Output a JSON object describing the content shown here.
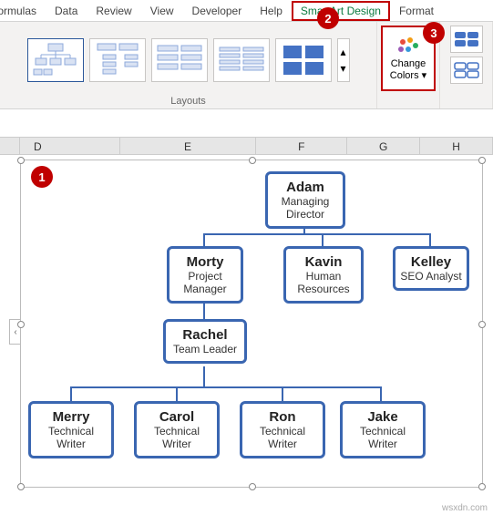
{
  "ribbon": {
    "tabs": [
      "Formulas",
      "Data",
      "Review",
      "View",
      "Developer",
      "Help",
      "SmartArt Design",
      "Format"
    ],
    "active_tab": "SmartArt Design",
    "groups": {
      "layouts": "Layouts"
    },
    "change_colors": {
      "label_line1": "Change",
      "label_line2": "Colors"
    }
  },
  "chart_data": {
    "type": "org-chart",
    "nodes": [
      {
        "id": "adam",
        "name": "Adam",
        "title": "Managing Director",
        "parent": null
      },
      {
        "id": "morty",
        "name": "Morty",
        "title": "Project Manager",
        "parent": "adam"
      },
      {
        "id": "kavin",
        "name": "Kavin",
        "title": "Human Resources",
        "parent": "adam"
      },
      {
        "id": "kelley",
        "name": "Kelley",
        "title": "SEO Analyst",
        "parent": "adam"
      },
      {
        "id": "rachel",
        "name": "Rachel",
        "title": "Team Leader",
        "parent": "morty"
      },
      {
        "id": "merry",
        "name": "Merry",
        "title": "Technical Writer",
        "parent": "rachel"
      },
      {
        "id": "carol",
        "name": "Carol",
        "title": "Technical Writer",
        "parent": "rachel"
      },
      {
        "id": "ron",
        "name": "Ron",
        "title": "Technical Writer",
        "parent": "rachel"
      },
      {
        "id": "jake",
        "name": "Jake",
        "title": "Technical Writer",
        "parent": "rachel"
      }
    ]
  },
  "columns": [
    "D",
    "E",
    "F",
    "G",
    "H"
  ],
  "badges": {
    "b1": "1",
    "b2": "2",
    "b3": "3"
  },
  "watermark": "wsxdn.com"
}
